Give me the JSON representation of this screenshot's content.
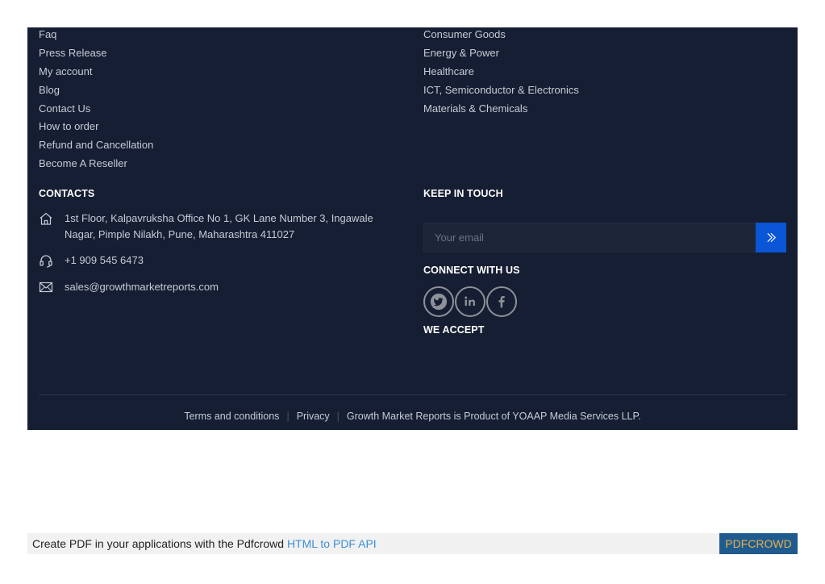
{
  "footer": {
    "left_links": [
      "Faq",
      "Press Release",
      "My account",
      "Blog",
      "Contact Us",
      "How to order",
      "Refund and Cancellation",
      "Become A Reseller"
    ],
    "right_links": [
      "Consumer Goods",
      "Energy & Power",
      "Healthcare",
      "ICT, Semiconductor & Electronics",
      "Materials & Chemicals"
    ],
    "contacts": {
      "title": "CONTACTS",
      "address": "1st Floor, Kalpavruksha Office No 1, GK Lane Number 3, Ingawale Nagar, Pimple Nilakh, Pune, Maharashtra 411027",
      "phone": "+1 909 545 6473",
      "email": "sales@growthmarketreports.com",
      "icons": [
        "home-icon",
        "headset-icon",
        "envelope-icon"
      ]
    },
    "keep_in_touch": {
      "title": "KEEP IN TOUCH",
      "email_placeholder": "Your email",
      "submit_icon": "double-chevron-right-icon"
    },
    "connect": {
      "title": "CONNECT WITH US",
      "social": [
        "twitter-icon",
        "linkedin-icon",
        "facebook-icon"
      ]
    },
    "we_accept": {
      "title": "WE ACCEPT"
    },
    "bottom": {
      "terms": "Terms and conditions",
      "privacy": "Privacy",
      "notice": "Growth Market Reports is Product of YOAAP Media Services LLP."
    }
  },
  "pdf_banner": {
    "text": "Create PDF in your applications with the Pdfcrowd ",
    "link": "HTML to PDF API",
    "brand": "PDFCROWD"
  },
  "colors": {
    "footer_bg": "#161e33",
    "accent_button": "#0a56d6",
    "pdf_brand_bg": "#1f5b8e",
    "pdf_brand_text": "#e8b04a"
  }
}
